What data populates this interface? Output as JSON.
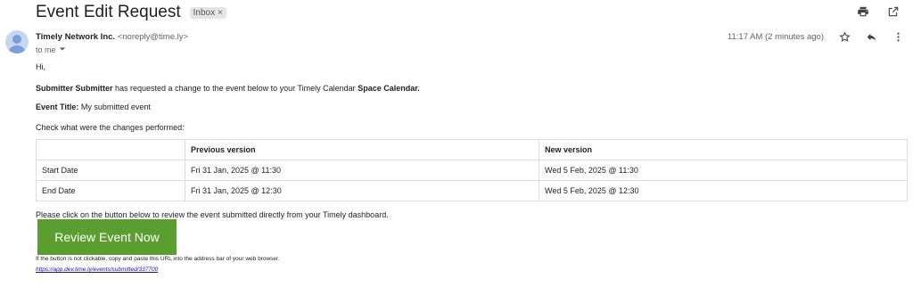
{
  "email": {
    "subject": "Event Edit Request",
    "label": "Inbox",
    "label_close": "×",
    "sender_name": "Timely Network Inc.",
    "sender_email": "<noreply@time.ly>",
    "to": "to me",
    "timestamp": "11:17 AM (2 minutes ago)"
  },
  "icons": {
    "print": "print-icon",
    "open_new": "open-in-new-window-icon",
    "star": "star-icon",
    "reply": "reply-icon",
    "more": "more-vertical-icon",
    "dropdown": "chevron-down-icon"
  },
  "content": {
    "greeting": "Hi,",
    "submitter": "Submitter Submitter",
    "request_text": " has requested a change to the event below to your Timely Calendar ",
    "calendar_name": "Space Calendar.",
    "event_title_label": "Event Title:",
    "event_title_value": " My submitted event",
    "check_text": "Check what were the changes performed:",
    "table": {
      "headers": [
        "",
        "Previous version",
        "New version"
      ],
      "rows": [
        [
          "Start Date",
          "Fri 31 Jan, 2025 @ 11:30",
          "Wed 5 Feb, 2025 @ 11:30"
        ],
        [
          "End Date",
          "Fri 31 Jan, 2025 @ 12:30",
          "Wed 5 Feb, 2025 @ 12:30"
        ]
      ]
    },
    "review_text": "Please click on the button below to review the event submitted directly from your Timely dashboard.",
    "review_button": "Review Event Now",
    "note": "If the button is not clickable, copy and paste this URL into the address bar of your web browser.",
    "url": "https://app.dev.time.ly/events/submitted/337700"
  },
  "colors": {
    "button_bg": "#5a9e2f",
    "link": "#1a0dab",
    "avatar_bg": "#c7d7f0"
  }
}
